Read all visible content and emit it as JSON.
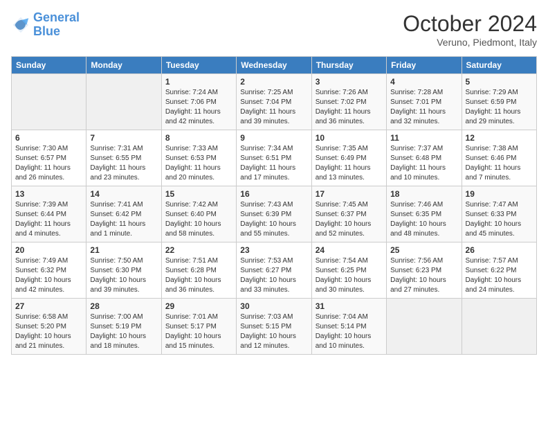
{
  "header": {
    "logo": {
      "line1": "General",
      "line2": "Blue"
    },
    "title": "October 2024",
    "subtitle": "Veruno, Piedmont, Italy"
  },
  "days_of_week": [
    "Sunday",
    "Monday",
    "Tuesday",
    "Wednesday",
    "Thursday",
    "Friday",
    "Saturday"
  ],
  "weeks": [
    [
      {
        "day": "",
        "sunrise": "",
        "sunset": "",
        "daylight": ""
      },
      {
        "day": "",
        "sunrise": "",
        "sunset": "",
        "daylight": ""
      },
      {
        "day": "1",
        "sunrise": "Sunrise: 7:24 AM",
        "sunset": "Sunset: 7:06 PM",
        "daylight": "Daylight: 11 hours and 42 minutes."
      },
      {
        "day": "2",
        "sunrise": "Sunrise: 7:25 AM",
        "sunset": "Sunset: 7:04 PM",
        "daylight": "Daylight: 11 hours and 39 minutes."
      },
      {
        "day": "3",
        "sunrise": "Sunrise: 7:26 AM",
        "sunset": "Sunset: 7:02 PM",
        "daylight": "Daylight: 11 hours and 36 minutes."
      },
      {
        "day": "4",
        "sunrise": "Sunrise: 7:28 AM",
        "sunset": "Sunset: 7:01 PM",
        "daylight": "Daylight: 11 hours and 32 minutes."
      },
      {
        "day": "5",
        "sunrise": "Sunrise: 7:29 AM",
        "sunset": "Sunset: 6:59 PM",
        "daylight": "Daylight: 11 hours and 29 minutes."
      }
    ],
    [
      {
        "day": "6",
        "sunrise": "Sunrise: 7:30 AM",
        "sunset": "Sunset: 6:57 PM",
        "daylight": "Daylight: 11 hours and 26 minutes."
      },
      {
        "day": "7",
        "sunrise": "Sunrise: 7:31 AM",
        "sunset": "Sunset: 6:55 PM",
        "daylight": "Daylight: 11 hours and 23 minutes."
      },
      {
        "day": "8",
        "sunrise": "Sunrise: 7:33 AM",
        "sunset": "Sunset: 6:53 PM",
        "daylight": "Daylight: 11 hours and 20 minutes."
      },
      {
        "day": "9",
        "sunrise": "Sunrise: 7:34 AM",
        "sunset": "Sunset: 6:51 PM",
        "daylight": "Daylight: 11 hours and 17 minutes."
      },
      {
        "day": "10",
        "sunrise": "Sunrise: 7:35 AM",
        "sunset": "Sunset: 6:49 PM",
        "daylight": "Daylight: 11 hours and 13 minutes."
      },
      {
        "day": "11",
        "sunrise": "Sunrise: 7:37 AM",
        "sunset": "Sunset: 6:48 PM",
        "daylight": "Daylight: 11 hours and 10 minutes."
      },
      {
        "day": "12",
        "sunrise": "Sunrise: 7:38 AM",
        "sunset": "Sunset: 6:46 PM",
        "daylight": "Daylight: 11 hours and 7 minutes."
      }
    ],
    [
      {
        "day": "13",
        "sunrise": "Sunrise: 7:39 AM",
        "sunset": "Sunset: 6:44 PM",
        "daylight": "Daylight: 11 hours and 4 minutes."
      },
      {
        "day": "14",
        "sunrise": "Sunrise: 7:41 AM",
        "sunset": "Sunset: 6:42 PM",
        "daylight": "Daylight: 11 hours and 1 minute."
      },
      {
        "day": "15",
        "sunrise": "Sunrise: 7:42 AM",
        "sunset": "Sunset: 6:40 PM",
        "daylight": "Daylight: 10 hours and 58 minutes."
      },
      {
        "day": "16",
        "sunrise": "Sunrise: 7:43 AM",
        "sunset": "Sunset: 6:39 PM",
        "daylight": "Daylight: 10 hours and 55 minutes."
      },
      {
        "day": "17",
        "sunrise": "Sunrise: 7:45 AM",
        "sunset": "Sunset: 6:37 PM",
        "daylight": "Daylight: 10 hours and 52 minutes."
      },
      {
        "day": "18",
        "sunrise": "Sunrise: 7:46 AM",
        "sunset": "Sunset: 6:35 PM",
        "daylight": "Daylight: 10 hours and 48 minutes."
      },
      {
        "day": "19",
        "sunrise": "Sunrise: 7:47 AM",
        "sunset": "Sunset: 6:33 PM",
        "daylight": "Daylight: 10 hours and 45 minutes."
      }
    ],
    [
      {
        "day": "20",
        "sunrise": "Sunrise: 7:49 AM",
        "sunset": "Sunset: 6:32 PM",
        "daylight": "Daylight: 10 hours and 42 minutes."
      },
      {
        "day": "21",
        "sunrise": "Sunrise: 7:50 AM",
        "sunset": "Sunset: 6:30 PM",
        "daylight": "Daylight: 10 hours and 39 minutes."
      },
      {
        "day": "22",
        "sunrise": "Sunrise: 7:51 AM",
        "sunset": "Sunset: 6:28 PM",
        "daylight": "Daylight: 10 hours and 36 minutes."
      },
      {
        "day": "23",
        "sunrise": "Sunrise: 7:53 AM",
        "sunset": "Sunset: 6:27 PM",
        "daylight": "Daylight: 10 hours and 33 minutes."
      },
      {
        "day": "24",
        "sunrise": "Sunrise: 7:54 AM",
        "sunset": "Sunset: 6:25 PM",
        "daylight": "Daylight: 10 hours and 30 minutes."
      },
      {
        "day": "25",
        "sunrise": "Sunrise: 7:56 AM",
        "sunset": "Sunset: 6:23 PM",
        "daylight": "Daylight: 10 hours and 27 minutes."
      },
      {
        "day": "26",
        "sunrise": "Sunrise: 7:57 AM",
        "sunset": "Sunset: 6:22 PM",
        "daylight": "Daylight: 10 hours and 24 minutes."
      }
    ],
    [
      {
        "day": "27",
        "sunrise": "Sunrise: 6:58 AM",
        "sunset": "Sunset: 5:20 PM",
        "daylight": "Daylight: 10 hours and 21 minutes."
      },
      {
        "day": "28",
        "sunrise": "Sunrise: 7:00 AM",
        "sunset": "Sunset: 5:19 PM",
        "daylight": "Daylight: 10 hours and 18 minutes."
      },
      {
        "day": "29",
        "sunrise": "Sunrise: 7:01 AM",
        "sunset": "Sunset: 5:17 PM",
        "daylight": "Daylight: 10 hours and 15 minutes."
      },
      {
        "day": "30",
        "sunrise": "Sunrise: 7:03 AM",
        "sunset": "Sunset: 5:15 PM",
        "daylight": "Daylight: 10 hours and 12 minutes."
      },
      {
        "day": "31",
        "sunrise": "Sunrise: 7:04 AM",
        "sunset": "Sunset: 5:14 PM",
        "daylight": "Daylight: 10 hours and 10 minutes."
      },
      {
        "day": "",
        "sunrise": "",
        "sunset": "",
        "daylight": ""
      },
      {
        "day": "",
        "sunrise": "",
        "sunset": "",
        "daylight": ""
      }
    ]
  ]
}
